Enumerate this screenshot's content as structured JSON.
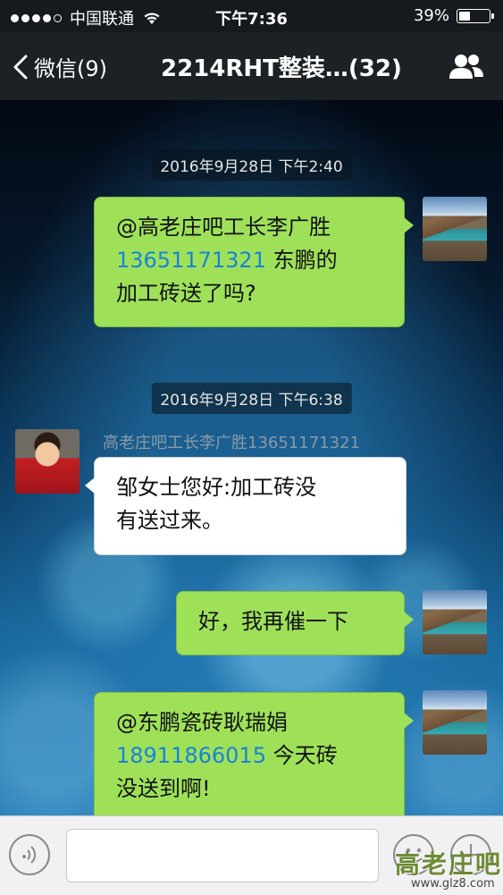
{
  "status_bar": {
    "carrier": "中国联通",
    "time": "下午7:36",
    "battery": "39%",
    "battery_level": 0.39,
    "signal_bars": 4
  },
  "nav": {
    "back_label": "微信(9)",
    "title": "2214RHT整装…(32)"
  },
  "messages": [
    {
      "type": "timestamp",
      "text": "2016年9月28日  下午2:40"
    },
    {
      "type": "outgoing",
      "line1": "@高老庄吧工长李广胜",
      "phone": "13651171321",
      "line2_rest": " 东鹏的",
      "line3": "加工砖送了吗?"
    },
    {
      "type": "timestamp",
      "text": "2016年9月28日  下午6:38"
    },
    {
      "type": "incoming",
      "sender": "高老庄吧工长李广胜13651171321",
      "line1": "邹女士您好:加工砖没",
      "line2": "有送过来。"
    },
    {
      "type": "outgoing",
      "text": "好，我再催一下"
    },
    {
      "type": "outgoing",
      "line1": "@东鹏瓷砖耿瑞娟",
      "phone": "18911866015",
      "line2_rest": " 今天砖",
      "line3": "没送到啊!"
    }
  ],
  "input_bar": {
    "text_value": ""
  },
  "watermark": {
    "text": "高老庄吧",
    "url": "www.glz8.com"
  },
  "colors": {
    "outgoing_bubble": "#9ee159",
    "incoming_bubble": "#ffffff",
    "phone_link": "#1a82d6",
    "nav_bg": "#1c2126"
  },
  "icons": {
    "back": "chevron-left-icon",
    "members": "group-members-icon",
    "wifi": "wifi-icon",
    "voice": "voice-icon",
    "emoji": "emoji-icon",
    "plus": "plus-icon"
  }
}
